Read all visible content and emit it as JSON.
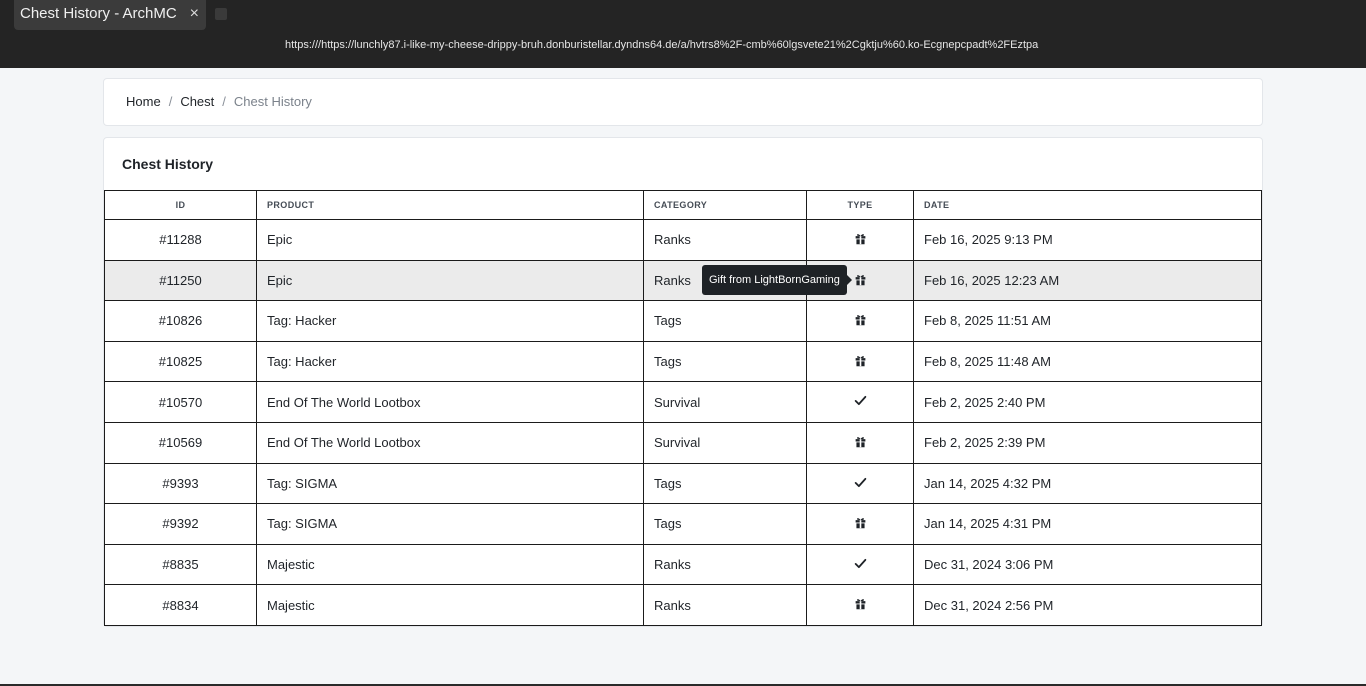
{
  "browser": {
    "tab_title": "Chest History - ArchMC",
    "tab_close": "×",
    "url": "https:///https://lunchly87.i-like-my-cheese-drippy-bruh.donburistellar.dyndns64.de/a/hvtrs8%2F-cmb%60lgsvete21%2Cgktju%60.ko-Ecgnepcpadt%2FEztpa"
  },
  "breadcrumb": {
    "home": "Home",
    "chest": "Chest",
    "current": "Chest History",
    "separator": "/"
  },
  "card": {
    "title": "Chest History"
  },
  "table": {
    "headers": {
      "id": "ID",
      "product": "PRODUCT",
      "category": "CATEGORY",
      "type": "TYPE",
      "date": "DATE"
    },
    "rows": [
      {
        "id": "#11288",
        "product": "Epic",
        "category": "Ranks",
        "type_icon": "gift-icon",
        "date": "Feb 16, 2025 9:13 PM"
      },
      {
        "id": "#11250",
        "product": "Epic",
        "category": "Ranks",
        "type_icon": "gift-icon",
        "date": "Feb 16, 2025 12:23 AM"
      },
      {
        "id": "#10826",
        "product": "Tag: Hacker",
        "category": "Tags",
        "type_icon": "gift-icon",
        "date": "Feb 8, 2025 11:51 AM"
      },
      {
        "id": "#10825",
        "product": "Tag: Hacker",
        "category": "Tags",
        "type_icon": "gift-icon",
        "date": "Feb 8, 2025 11:48 AM"
      },
      {
        "id": "#10570",
        "product": "End Of The World Lootbox",
        "category": "Survival",
        "type_icon": "check-icon",
        "date": "Feb 2, 2025 2:40 PM"
      },
      {
        "id": "#10569",
        "product": "End Of The World Lootbox",
        "category": "Survival",
        "type_icon": "gift-icon",
        "date": "Feb 2, 2025 2:39 PM"
      },
      {
        "id": "#9393",
        "product": "Tag: SIGMA",
        "category": "Tags",
        "type_icon": "check-icon",
        "date": "Jan 14, 2025 4:32 PM"
      },
      {
        "id": "#9392",
        "product": "Tag: SIGMA",
        "category": "Tags",
        "type_icon": "gift-icon",
        "date": "Jan 14, 2025 4:31 PM"
      },
      {
        "id": "#8835",
        "product": "Majestic",
        "category": "Ranks",
        "type_icon": "check-icon",
        "date": "Dec 31, 2024 3:06 PM"
      },
      {
        "id": "#8834",
        "product": "Majestic",
        "category": "Ranks",
        "type_icon": "gift-icon",
        "date": "Dec 31, 2024 2:56 PM"
      }
    ]
  },
  "tooltip": {
    "text": "Gift from LightBornGaming"
  }
}
